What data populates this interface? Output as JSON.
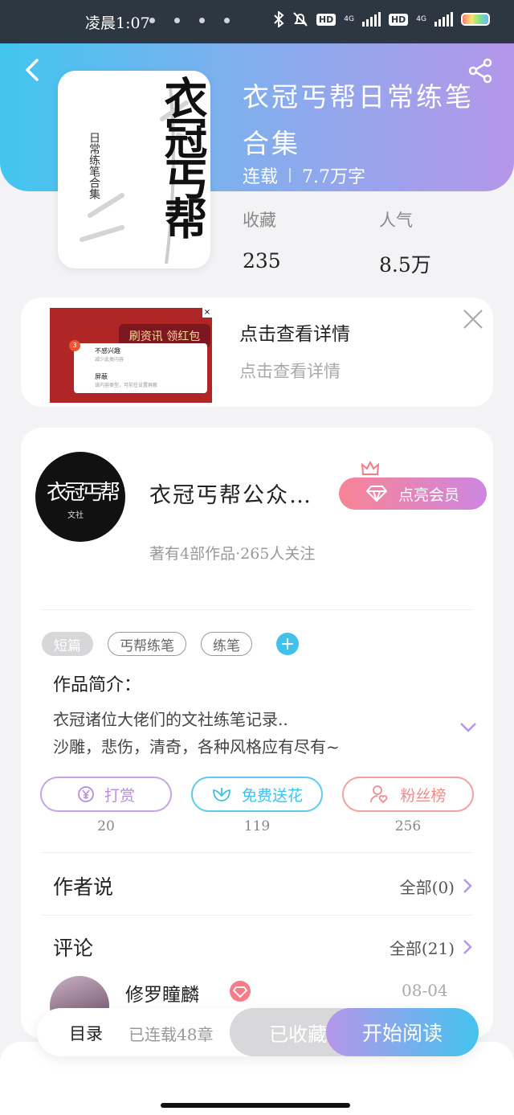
{
  "status_bar": {
    "time": "凌晨1:07",
    "hd1": "HD",
    "hd2": "HD",
    "net1": "4G",
    "net2": "4G"
  },
  "book": {
    "title": "衣冠丐帮日常练笔合集",
    "status": "连载",
    "word_count": "7.7万字",
    "cover_text": {
      "main": "衣冠丐帮",
      "sub": "日常练笔合集"
    },
    "stats": [
      {
        "label": "收藏",
        "value": "235"
      },
      {
        "label": "人气",
        "value": "8.5万"
      }
    ]
  },
  "ad": {
    "title": "点击查看详情",
    "subtitle": "点击查看详情",
    "image_text": {
      "banner": "刷资讯 领红包",
      "badge": "3",
      "opt1_title": "不感兴趣",
      "opt1_sub": "减少此类内容",
      "opt2_title": "屏蔽",
      "opt2_sub": "该内容类型，可前往设置屏蔽"
    }
  },
  "author": {
    "name": "衣冠丐帮公众…",
    "vip_label": "点亮会员",
    "stats": "著有4部作品·265人关注",
    "avatar_text": {
      "main": "衣冠丐帮",
      "sub": "文社"
    }
  },
  "tags": [
    "短篇",
    "丐帮练笔",
    "练笔"
  ],
  "intro": {
    "heading": "作品简介：",
    "line1": "衣冠诸位大佬们的文社练笔记录..",
    "line2": "沙雕，悲伤，清奇，各种风格应有尽有~"
  },
  "actions": [
    {
      "label": "打赏",
      "count": "20",
      "color": "#b88ce0"
    },
    {
      "label": "免费送花",
      "count": "119",
      "color": "#3fc1ea"
    },
    {
      "label": "粉丝榜",
      "count": "256",
      "color": "#f08c8c"
    }
  ],
  "author_says": {
    "heading": "作者说",
    "more": "全部(0)"
  },
  "comments": {
    "heading": "评论",
    "more": "全部(21)",
    "first": {
      "user": "修罗瞳麟",
      "date": "08-04"
    }
  },
  "bottom_bar": {
    "toc": "目录",
    "serial": "已连载48章",
    "collected": "已收藏",
    "read": "开始阅读"
  },
  "colors": {
    "accent_blue": "#41c6ef",
    "accent_purple": "#b596ea",
    "vip_pink": "#f88495"
  }
}
